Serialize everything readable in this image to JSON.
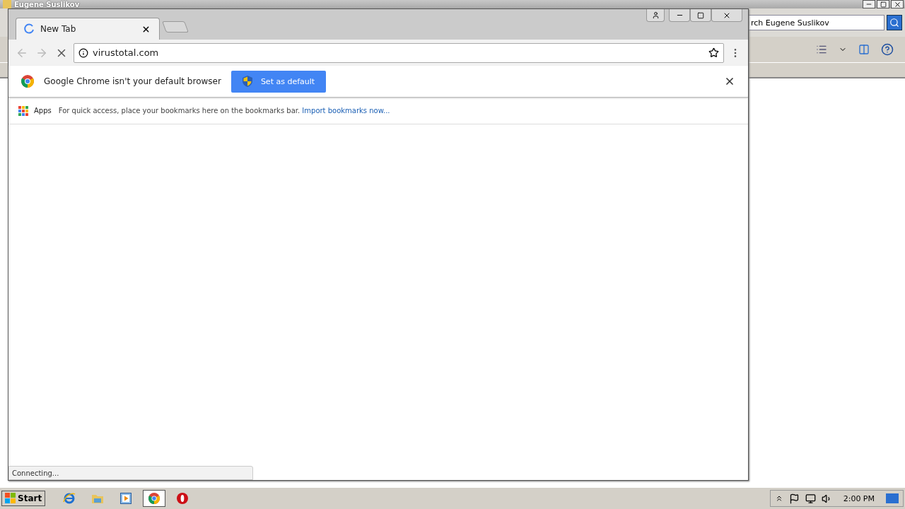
{
  "background_window": {
    "title": "Eugene Suslikov",
    "search": {
      "value": "rch Eugene Suslikov"
    }
  },
  "browser": {
    "tabs": [
      {
        "title": "New Tab",
        "loading": true,
        "selected": true
      }
    ],
    "address": "virustotal.com",
    "infobar": {
      "message": "Google Chrome isn't your default browser",
      "button": "Set as default"
    },
    "bookmarks_bar": {
      "apps": "Apps",
      "message": "For quick access, place your bookmarks here on the bookmarks bar.",
      "link": "Import bookmarks now..."
    },
    "status": "Connecting..."
  },
  "taskbar": {
    "start": "Start",
    "apps": [
      {
        "kind": "ie",
        "selected": false
      },
      {
        "kind": "folder",
        "selected": false
      },
      {
        "kind": "media",
        "selected": false
      },
      {
        "kind": "chrome",
        "selected": true
      },
      {
        "kind": "opera",
        "selected": false
      }
    ],
    "clock": "2:00 PM"
  }
}
